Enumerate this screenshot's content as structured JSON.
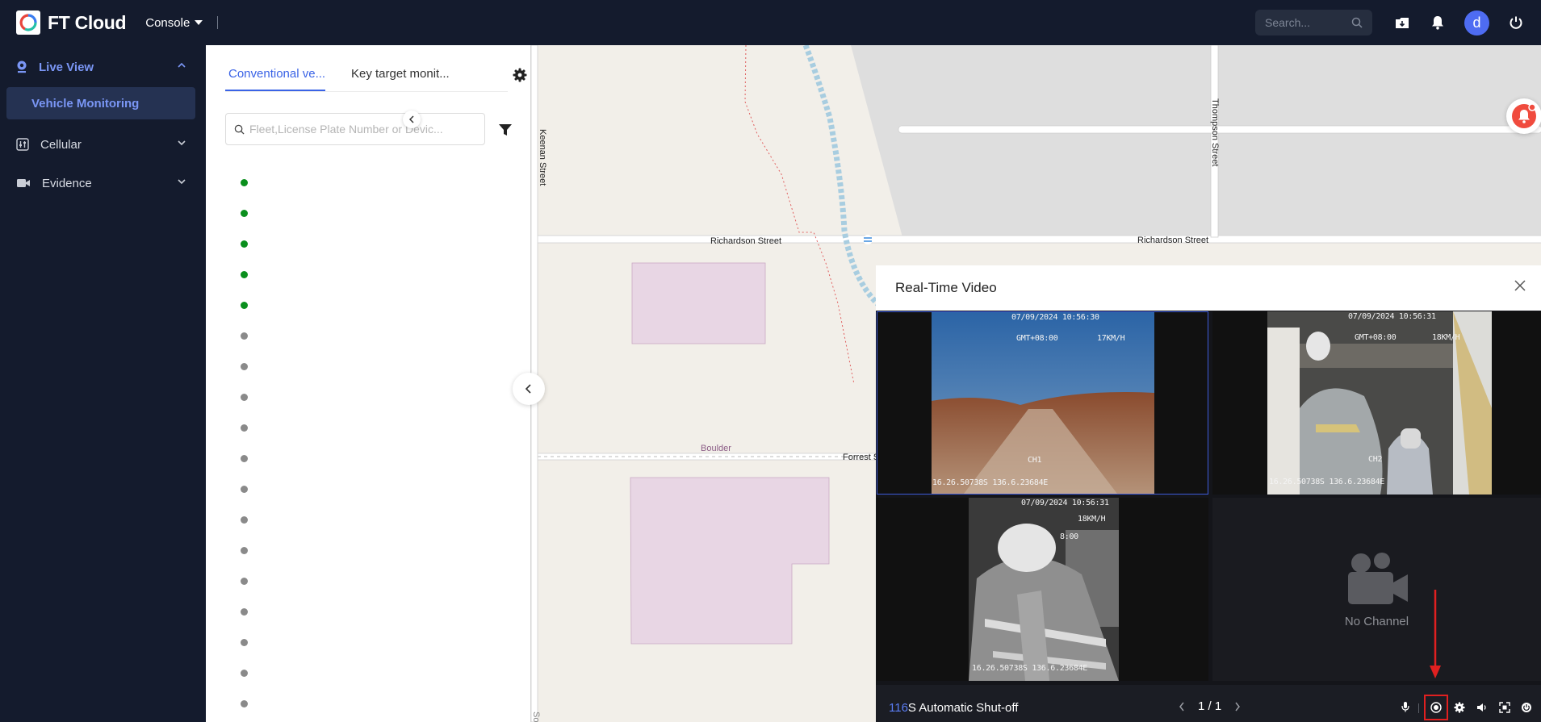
{
  "app": {
    "name": "FT Cloud",
    "console_label": "Console",
    "search_placeholder": "Search...",
    "avatar_letter": "d"
  },
  "sidebar": {
    "items": [
      {
        "label": "Live View",
        "icon": "camera-icon",
        "expanded": true
      },
      {
        "label": "Cellular",
        "icon": "cellular-icon"
      },
      {
        "label": "Evidence",
        "icon": "evidence-video-icon"
      }
    ],
    "active_subitem": "Vehicle Monitoring"
  },
  "panel": {
    "tabs": [
      "Conventional ve...",
      "Key target monit..."
    ],
    "active_tab": 0,
    "search_placeholder": "Fleet,License Plate Number or Devic...",
    "vehicle_status": [
      "online",
      "online",
      "online",
      "online",
      "online",
      "offline",
      "offline",
      "offline",
      "offline",
      "offline",
      "offline",
      "offline",
      "offline",
      "offline",
      "offline",
      "offline",
      "offline",
      "offline"
    ]
  },
  "map": {
    "streets": [
      "Richardson Street",
      "Richardson Street",
      "Keenan Street",
      "Thompson Street",
      "Forrest S",
      "Boulder",
      "So"
    ]
  },
  "video": {
    "title": "Real-Time Video",
    "channels": [
      {
        "date": "07/09/2024 10:56:30",
        "tz": "GMT+08:00",
        "speed": "17KM/H",
        "label": "CH1",
        "gps": "16.26.50738S 136.6.23684E"
      },
      {
        "date": "07/09/2024 10:56:31",
        "tz": "GMT+08:00",
        "speed": "18KM/H",
        "label": "CH2",
        "gps": "16.26.50738S 136.6.23684E"
      },
      {
        "date": "07/09/2024 10:56:31",
        "tz": "8:00",
        "speed": "18KM/H",
        "gps": "16.26.50738S 136.6.23684E"
      }
    ],
    "no_channel_label": "No Channel",
    "footer": {
      "vehicle_code": "116",
      "vehicle_name": "S Automatic Shut-off",
      "page": "1 / 1"
    }
  },
  "colors": {
    "accent": "#3a63e6",
    "nav_bg": "#141b2d",
    "online": "#0a8f1d",
    "offline": "#8a8a8a",
    "highlight": "#e02020"
  }
}
